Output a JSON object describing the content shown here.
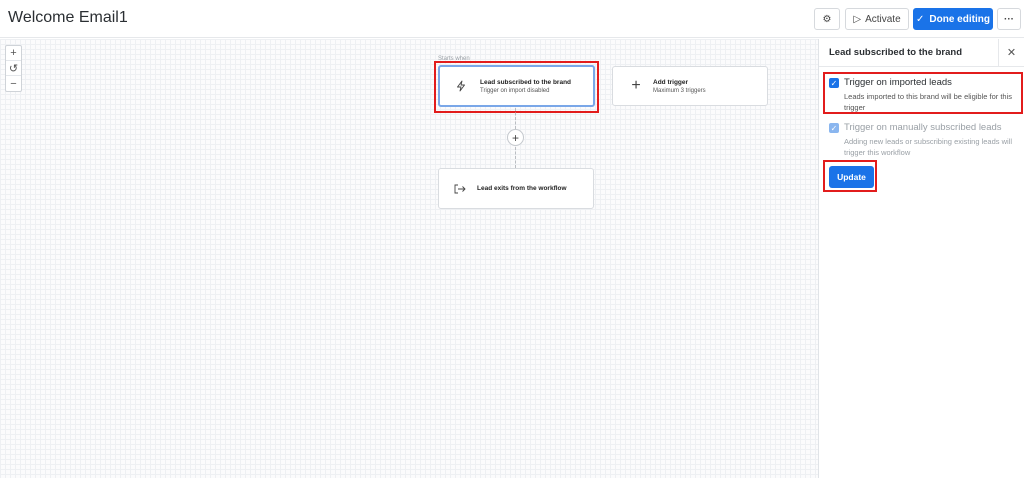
{
  "header": {
    "title": "Welcome Email1",
    "activate_label": "Activate",
    "done_label": "Done editing",
    "more_label": "···"
  },
  "canvas": {
    "zoom_in": "+",
    "reset": "↺",
    "zoom_out": "−",
    "starts_when": "Starts when",
    "trigger_card": {
      "title": "Lead subscribed to the brand",
      "subtitle": "Trigger on import disabled"
    },
    "add_card": {
      "title": "Add trigger",
      "subtitle": "Maximum 3 triggers"
    },
    "add_step": "+",
    "exit_card": {
      "title": "Lead exits from the workflow"
    }
  },
  "panel": {
    "title": "Lead subscribed to the brand",
    "options": [
      {
        "label": "Trigger on imported leads",
        "description": "Leads imported to this brand will be eligible for this trigger",
        "checked": true
      },
      {
        "label": "Trigger on manually subscribed leads",
        "description": "Adding new leads or subscribing existing leads will trigger this workflow",
        "checked": true
      }
    ],
    "update_label": "Update"
  },
  "colors": {
    "accent": "#1a73e8",
    "highlight": "#e21c1c"
  },
  "icons": [
    "settings-icon",
    "play-icon",
    "check-icon",
    "more-icon",
    "lightning-icon",
    "plus-icon",
    "exit-icon",
    "close-icon"
  ]
}
